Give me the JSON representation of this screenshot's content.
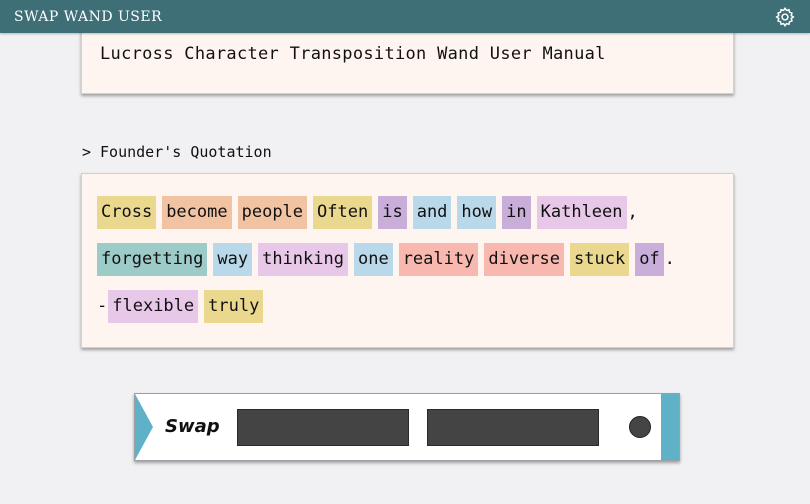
{
  "app": {
    "title": "SWAP WAND USER"
  },
  "icons": {
    "settings": "gear-icon",
    "section_toggle": "chevron-right-icon"
  },
  "manual": {
    "title": "Lucross Character Transposition Wand User Manual"
  },
  "section": {
    "chevron": ">",
    "title": "Founder's Quotation"
  },
  "quote": {
    "lines": [
      {
        "tokens": [
          {
            "text": "Cross",
            "color": "#ebd88f"
          },
          {
            "text": "become",
            "color": "#f2c3a2"
          },
          {
            "text": "people",
            "color": "#f2c3a2"
          },
          {
            "text": "Often",
            "color": "#ebd88f"
          },
          {
            "text": "is",
            "color": "#c8aed9"
          },
          {
            "text": "and",
            "color": "#b9d8ea"
          },
          {
            "text": "how",
            "color": "#b9d8ea"
          },
          {
            "text": "in",
            "color": "#c8aed9"
          },
          {
            "text": "Kathleen",
            "color": "#e8c8e8"
          }
        ],
        "trail": ","
      },
      {
        "tokens": [
          {
            "text": "forgetting",
            "color": "#9ccbc8"
          },
          {
            "text": "way",
            "color": "#b9d8ea"
          },
          {
            "text": "thinking",
            "color": "#e8c8e8"
          },
          {
            "text": "one",
            "color": "#b9d8ea"
          },
          {
            "text": "reality",
            "color": "#f8b8b0"
          },
          {
            "text": "diverse",
            "color": "#f8b8b0"
          },
          {
            "text": "stuck",
            "color": "#ebd88f"
          },
          {
            "text": "of",
            "color": "#c8aed9"
          }
        ],
        "trail": "."
      },
      {
        "lead": "-",
        "tokens": [
          {
            "text": "flexible",
            "color": "#e8c8e8"
          },
          {
            "text": "truly",
            "color": "#ebd88f"
          }
        ],
        "trail": ""
      }
    ]
  },
  "wand": {
    "label": "Swap",
    "slot_a": "",
    "slot_b": "",
    "colors": {
      "accent": "#5eb1c6",
      "slot": "#444444"
    }
  }
}
